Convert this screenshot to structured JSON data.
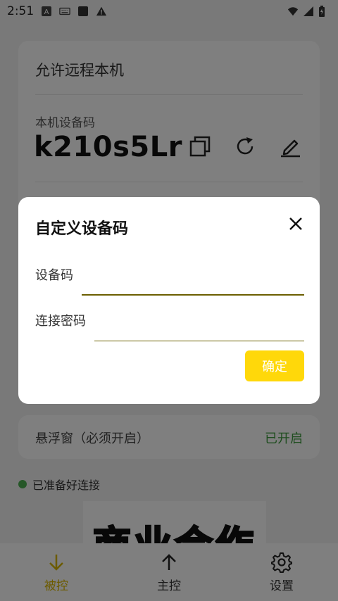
{
  "status_bar": {
    "time": "2:51",
    "icons": [
      "a-icon",
      "keyboard-icon",
      "square-icon",
      "warning-icon",
      "wifi-icon",
      "signal-icon",
      "battery-icon"
    ]
  },
  "remote_card": {
    "title": "允许远程本机",
    "device_code_label": "本机设备码",
    "device_code": "k210s5Lr",
    "actions": [
      "copy-icon",
      "refresh-icon",
      "edit-icon"
    ]
  },
  "floating_window": {
    "label": "悬浮窗（必须开启）",
    "status": "已开启"
  },
  "ready": {
    "text": "已准备好连接"
  },
  "banner": {
    "text": "商业合作"
  },
  "bottom_nav": {
    "items": [
      {
        "label": "被控",
        "icon": "arrow-down-icon",
        "active": true
      },
      {
        "label": "主控",
        "icon": "arrow-up-icon",
        "active": false
      },
      {
        "label": "设置",
        "icon": "gear-icon",
        "active": false
      }
    ]
  },
  "dialog": {
    "title": "自定义设备码",
    "device_code_label": "设备码",
    "device_code_value": "",
    "password_label": "连接密码",
    "password_value": "",
    "confirm_label": "确定"
  },
  "colors": {
    "accent": "#ffd80a",
    "active_nav": "#d8b700",
    "enabled_status": "#3c9a3c",
    "ready_dot": "#4caf50"
  }
}
